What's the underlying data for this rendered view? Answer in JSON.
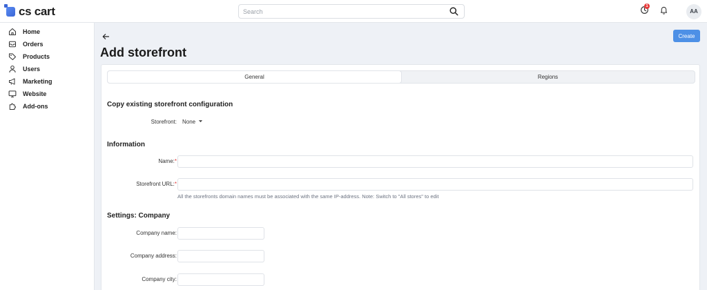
{
  "app": {
    "logo_text": "cs cart"
  },
  "search": {
    "placeholder": "Search"
  },
  "notifications": {
    "count": "1"
  },
  "user": {
    "initials": "AA"
  },
  "sidebar": {
    "items": [
      {
        "label": "Home",
        "icon": "home-icon"
      },
      {
        "label": "Orders",
        "icon": "orders-icon"
      },
      {
        "label": "Products",
        "icon": "tag-icon"
      },
      {
        "label": "Users",
        "icon": "user-icon"
      },
      {
        "label": "Marketing",
        "icon": "megaphone-icon"
      },
      {
        "label": "Website",
        "icon": "monitor-icon"
      },
      {
        "label": "Add-ons",
        "icon": "puzzle-icon"
      }
    ]
  },
  "page": {
    "title": "Add storefront",
    "create_label": "Create",
    "tabs": [
      {
        "label": "General",
        "active": true
      },
      {
        "label": "Regions",
        "active": false
      }
    ]
  },
  "form": {
    "copy_section": "Copy existing storefront configuration",
    "storefront_label": "Storefront:",
    "storefront_value": "None",
    "info_section": "Information",
    "name_label": "Name:",
    "url_label": "Storefront URL:",
    "required_mark": "*",
    "url_hint": "All the storefronts domain names must be associated with the same IP-address. Note: Switch to \"All stores\" to edit",
    "company_section": "Settings: Company",
    "company_name_label": "Company name:",
    "company_address_label": "Company address:",
    "company_city_label": "Company city:"
  },
  "colors": {
    "accent": "#4d90e6",
    "required": "#e23b3b",
    "badge": "#e63a3a"
  }
}
